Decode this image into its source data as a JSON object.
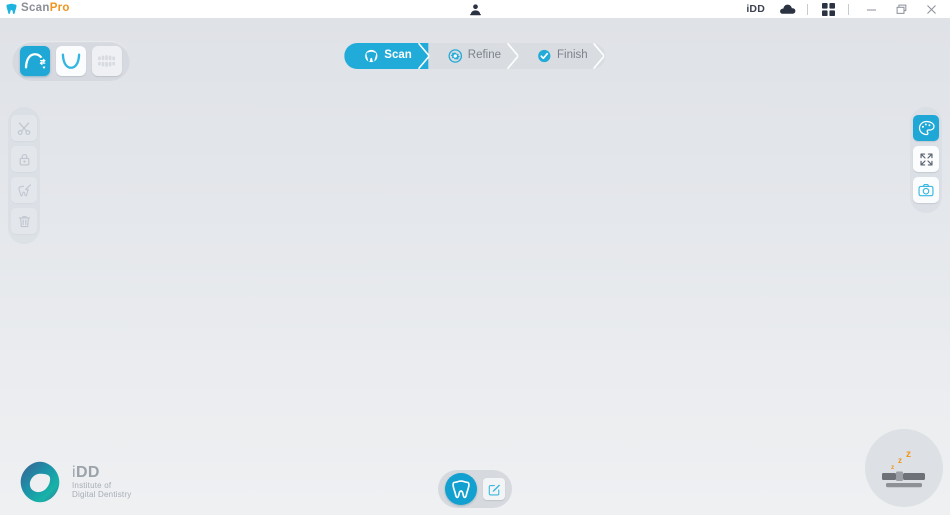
{
  "app": {
    "brand_scan": "Scan",
    "brand_pro": "Pro",
    "brand_icon": "tooth-icon"
  },
  "titlebar": {
    "account_icon": "user-icon",
    "org_label": "iDD",
    "cloud_icon": "cloud-icon",
    "grid_icon": "grid-apps-icon",
    "minimize_label": "–",
    "restore_icon": "restore-window-icon",
    "close_label": "✕"
  },
  "arch_toolbar": {
    "items": [
      {
        "name": "upper-arch",
        "icon": "upper-arch-icon",
        "state": "active"
      },
      {
        "name": "lower-arch",
        "icon": "lower-arch-icon",
        "state": "enabled"
      },
      {
        "name": "bite-registration",
        "icon": "bite-registration-icon",
        "state": "disabled"
      }
    ]
  },
  "steps": {
    "items": [
      {
        "label": "Scan",
        "icon": "tooth-circle-icon",
        "state": "active"
      },
      {
        "label": "Refine",
        "icon": "gear-icon",
        "state": "inactive"
      },
      {
        "label": "Finish",
        "icon": "check-circle-icon",
        "state": "inactive"
      }
    ]
  },
  "left_rail": {
    "items": [
      {
        "name": "trim-tool",
        "icon": "scissors-icon",
        "state": "disabled"
      },
      {
        "name": "lock-tool",
        "icon": "lock-icon",
        "state": "disabled"
      },
      {
        "name": "fill-tool",
        "icon": "tooth-tool-icon",
        "state": "disabled"
      },
      {
        "name": "delete-tool",
        "icon": "trash-icon",
        "state": "disabled"
      }
    ]
  },
  "right_rail": {
    "items": [
      {
        "name": "color-mode",
        "icon": "palette-icon",
        "state": "active"
      },
      {
        "name": "fit-to-view",
        "icon": "expand-arrows-icon",
        "state": "enabled"
      },
      {
        "name": "screenshot",
        "icon": "camera-icon",
        "state": "enabled"
      }
    ]
  },
  "bottom_bar": {
    "model_button": {
      "name": "model-view",
      "icon": "tooth-icon",
      "state": "active"
    },
    "edit_button": {
      "name": "edit-model",
      "icon": "edit-square-icon",
      "state": "enabled"
    }
  },
  "footer_logo": {
    "mark": "idd-triangle-icon",
    "title_i": "i",
    "title_dd": "DD",
    "sub_line1": "Institute of",
    "sub_line2": "Digital Dentistry"
  },
  "scanner_status": {
    "icon": "scanner-sleep-icon",
    "sleep_text": "zzz"
  },
  "colors": {
    "accent_cyan": "#21abd8",
    "accent_orange": "#f0951e",
    "rail_bg": "#d6dbe2",
    "canvas_top": "#dfe2e7",
    "canvas_bottom": "#eef0f2"
  }
}
